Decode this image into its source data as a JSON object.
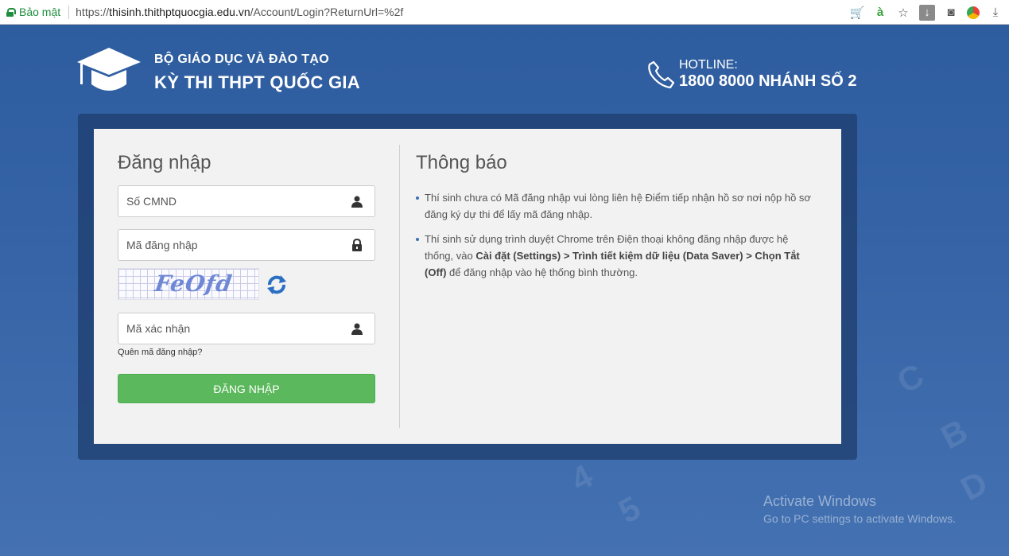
{
  "browser": {
    "secure_label": "Bảo mật",
    "url_scheme": "https://",
    "url_host": "thisinh.thithptquocgia.edu.vn",
    "url_path": "/Account/Login?ReturnUrl=%2f",
    "icons": [
      "cart-icon",
      "a-icon",
      "star-icon",
      "download-icon",
      "camera-icon",
      "color-icon",
      "download-arrow-icon"
    ]
  },
  "header": {
    "org": "BỘ GIÁO DỤC VÀ ĐÀO TẠO",
    "exam": "KỲ THI THPT QUỐC GIA",
    "hotline_label": "HOTLINE:",
    "hotline_number": "1800 8000 NHÁNH SỐ 2"
  },
  "login": {
    "title": "Đăng nhập",
    "cmnd_placeholder": "Số CMND",
    "code_placeholder": "Mã đăng nhập",
    "captcha_text": "FeOfd",
    "verify_placeholder": "Mã xác nhận",
    "forgot_link": "Quên mã đăng nhập?",
    "submit_label": "ĐĂNG NHẬP"
  },
  "notice": {
    "title": "Thông báo",
    "item1": "Thí sinh chưa có Mã đăng nhập vui lòng liên hệ Điểm tiếp nhận hồ sơ nơi nộp hồ sơ đăng ký dự thi để lấy mã đăng nhập.",
    "item2_pre": "Thí sinh sử dụng trình duyệt Chrome trên Điện thoại không đăng nhập được hệ thống, vào ",
    "item2_bold": "Cài đặt (Settings) > Trình tiết kiệm dữ liệu (Data Saver) > Chọn Tắt (Off)",
    "item2_post": " để đăng nhập vào hệ thống bình thường."
  },
  "watermark": {
    "line1": "Activate Windows",
    "line2": "Go to PC settings to activate Windows."
  },
  "colors": {
    "accent_green": "#5cb85c",
    "background_blue": "#2f5a9c",
    "secure_green": "#1e8e3e"
  }
}
